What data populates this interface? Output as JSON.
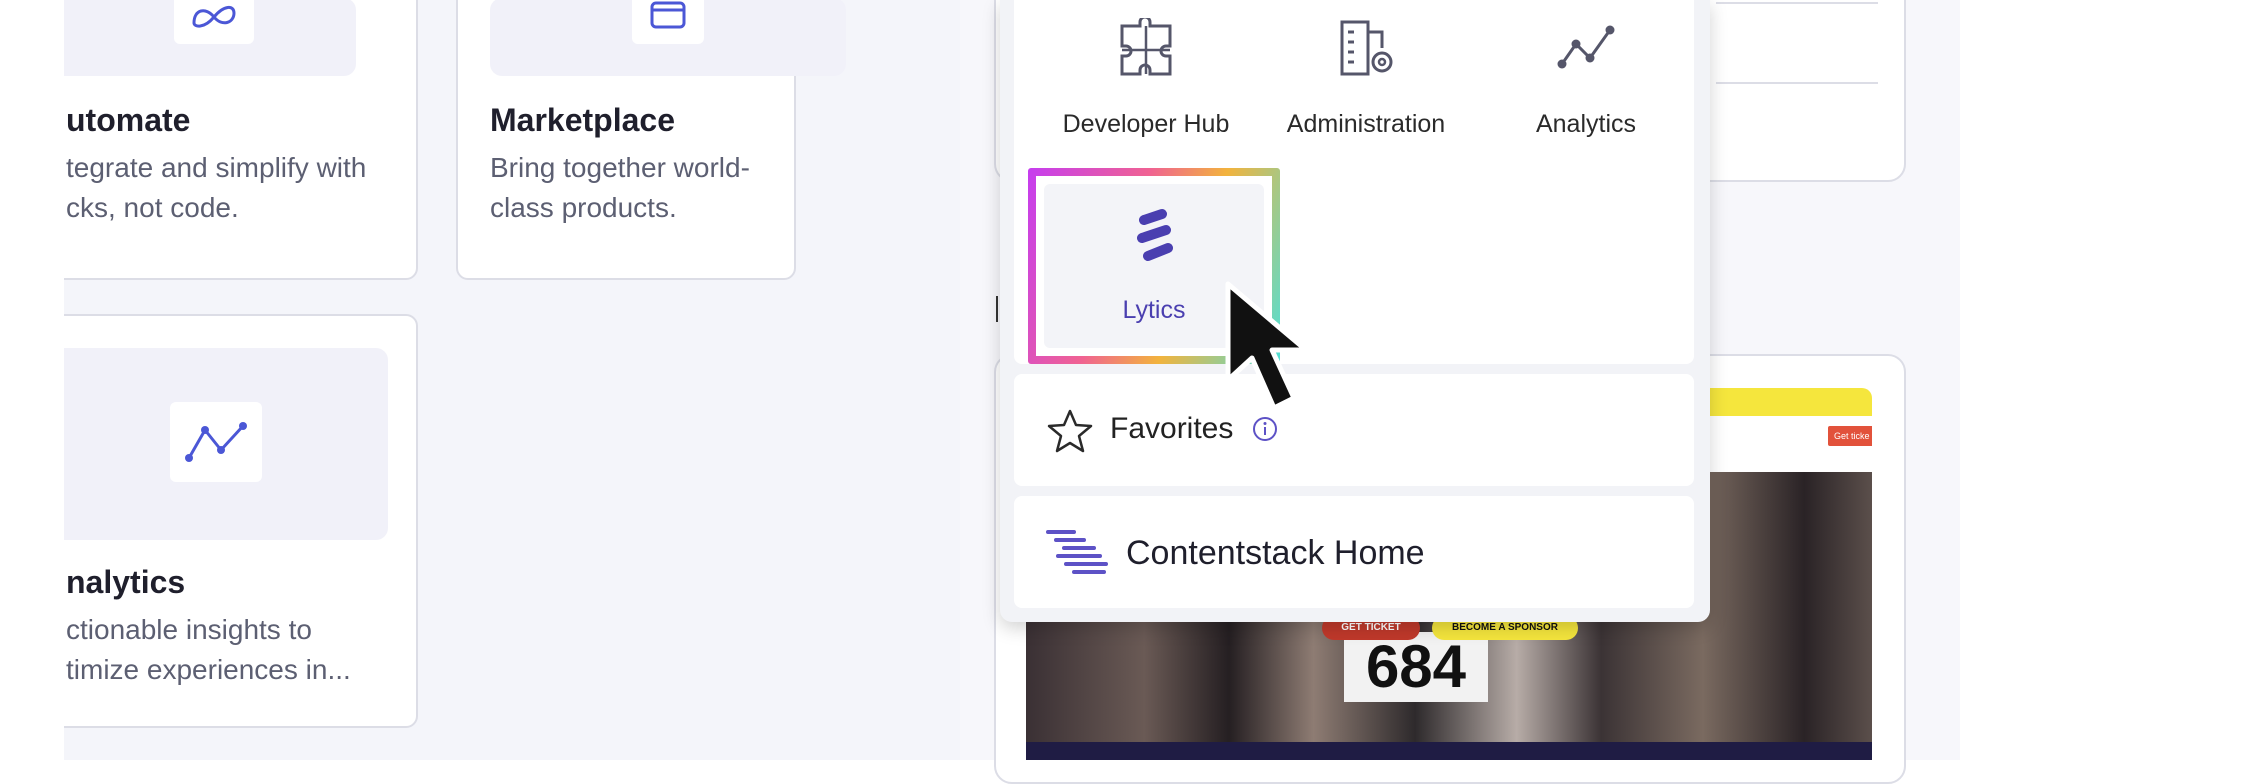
{
  "cards": [
    {
      "title": "utomate",
      "description": "tegrate and simplify with\ncks, not code.",
      "icon": "infinity-icon"
    },
    {
      "title": "Marketplace",
      "description": "Bring together world-\nclass products.",
      "icon": "marketplace-icon"
    },
    {
      "title": "nalytics",
      "description": "ctionable insights to\ntimize experiences in...",
      "icon": "analytics-icon"
    }
  ],
  "app_switcher": {
    "apps": [
      {
        "label": "Developer Hub",
        "icon": "puzzle-icon"
      },
      {
        "label": "Administration",
        "icon": "building-gear-icon"
      },
      {
        "label": "Analytics",
        "icon": "analytics-icon"
      },
      {
        "label": "Lytics",
        "icon": "lytics-logo-icon",
        "selected": true
      }
    ],
    "favorites": {
      "label": "Favorites",
      "icon": "star-icon",
      "info_icon": "info-icon"
    },
    "home": {
      "label": "Contentstack Home",
      "icon": "contentstack-logo-icon"
    }
  },
  "banner": {
    "cta_primary": "GET TICKET",
    "cta_secondary": "BECOME A SPONSOR",
    "corner_button": "Get ticke",
    "bib_number": "684"
  },
  "colors": {
    "accent": "#5d52c6",
    "icon_blue": "#4b57d6",
    "banner_yellow": "#f5e63d",
    "banner_red": "#e2523b"
  }
}
